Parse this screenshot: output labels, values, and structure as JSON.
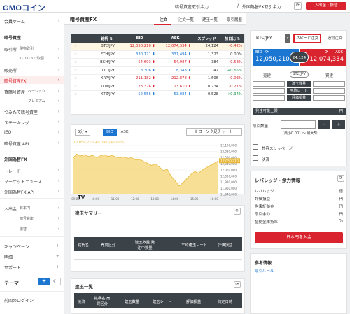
{
  "header": {
    "logo": "GMOコイン",
    "nav": [
      "暗号資産取引余力",
      "/",
      "外国為替FX取引余力"
    ],
    "deposit_button": "入出金・振替"
  },
  "sidebar": {
    "member_home": "会員ホーム",
    "crypto_title": "暗号資産",
    "exchange": "取引所",
    "exchange_sub1": "現物取引",
    "exchange_sub2": "レバレッジ取引",
    "sales": "販売所",
    "crypto_fx": "暗号資産FX",
    "lending": "貸暗号資産",
    "lending_sub1": "ベーシック",
    "lending_sub2": "プレミアム",
    "tsumitate": "つみたて暗号資産",
    "staking": "ステーキング",
    "ieo": "IEO",
    "api": "暗号資産 API",
    "fx_title": "外国為替FX",
    "trade": "トレード",
    "market_news": "マーケットニュース",
    "fx_api": "外国為替FX API",
    "io": "入出金",
    "io_sub1": "日本円",
    "io_sub2": "暗号資産",
    "io_sub3": "振替",
    "campaign": "キャンペーン",
    "statement": "明細",
    "support": "サポート",
    "theme": "テーマ",
    "last_login": "前回のログイン"
  },
  "main": {
    "title": "暗号資産FX",
    "tabs": [
      "注文",
      "注文一覧",
      "建玉一覧",
      "取引履歴"
    ],
    "rate_table": {
      "headers": [
        "銘柄",
        "BID",
        "ASK",
        "スプレッド",
        "前日比"
      ],
      "rows": [
        {
          "symbol": "BTC/JPY",
          "bid": "12,050,210",
          "bid_dir": "up",
          "ask": "12,074,334",
          "ask_dir": "up",
          "spread": "24,124",
          "change": "-0.42%"
        },
        {
          "symbol": "ETH/JPY",
          "bid": "330,171",
          "bid_dir": "down",
          "ask": "331,494",
          "ask_dir": "down",
          "spread": "1,323",
          "change": "0.00%"
        },
        {
          "symbol": "BCH/JPY",
          "bid": "54,603",
          "bid_dir": "up",
          "ask": "54,987",
          "ask_dir": "up",
          "spread": "384",
          "change": "-0.53%"
        },
        {
          "symbol": "LTC/JPY",
          "bid": "8,306",
          "bid_dir": "down",
          "ask": "8,348",
          "ask_dir": "down",
          "spread": "42",
          "change": "+0.65%"
        },
        {
          "symbol": "XRP/JPY",
          "bid": "211.182",
          "bid_dir": "up",
          "ask": "212.878",
          "ask_dir": "up",
          "spread": "1.696",
          "change": "-0.03%"
        },
        {
          "symbol": "XLM/JPY",
          "bid": "23.376",
          "bid_dir": "up",
          "ask": "23.610",
          "ask_dir": "up",
          "spread": "0.234",
          "change": "-0.21%"
        },
        {
          "symbol": "XTZ/JPY",
          "bid": "52.556",
          "bid_dir": "down",
          "ask": "53.084",
          "ask_dir": "down",
          "spread": "0.528",
          "change": "+0.34%"
        }
      ]
    },
    "chart_toolbar": {
      "interval": "5分",
      "bid": "BID",
      "ask": "ASK",
      "candle_button": "ローソク足チャート"
    },
    "chart_annotation": "12,050,210 +0.091 (+0.00%)",
    "summary": {
      "title": "建玉サマリー",
      "headers": [
        "銘柄名",
        "売買区分",
        "建玉数量 発注中数量",
        "平均建玉レート",
        "評価損益"
      ]
    },
    "positions": {
      "title": "建玉一覧",
      "headers": [
        "決済",
        "銘柄名 売買区分",
        "建玉数量",
        "建玉レート",
        "評価損益",
        "約定日時"
      ]
    }
  },
  "chart_data": {
    "type": "area",
    "x": [
      "09:00",
      "10:00",
      "11:00",
      "12:00",
      "13:00",
      "14:00",
      "15:00",
      "16:00"
    ],
    "y_ticks": [
      "12,100,000",
      "12,080,000",
      "12,060,000",
      "12,040,000",
      "12,020,000",
      "12,000,000",
      "11,980,000",
      "11,960,000",
      "11,940,000"
    ],
    "ylim": [
      11940000,
      12100000
    ],
    "current_label": "12,050,210",
    "series": [
      {
        "values": [
          12058000,
          12072000,
          12066000,
          12070000,
          12064000,
          12068000,
          12061000,
          12066000,
          12070000,
          12064000,
          12068000,
          12062000,
          12060000,
          12063000,
          12058000,
          12060000,
          12052000,
          12055000,
          12048000,
          12042000,
          12035000,
          12040000,
          12030000,
          12018000,
          12022000,
          12000000,
          11985000,
          11968000,
          11978000,
          11992000,
          12005000,
          12015000,
          12010000,
          12020000,
          12028000,
          12035000,
          12042000,
          12050210
        ]
      }
    ]
  },
  "order_panel": {
    "symbol": "BTC/JPY",
    "speed_button": "スピード注文",
    "normal_button": "通常注文",
    "bid_label": "BID",
    "bid_value": "12,050,210",
    "ask_label": "ASK",
    "ask_value": "12,074,334",
    "spread": "24,124",
    "sell": "売建",
    "buy": "買建",
    "pair_label": "BTC/JPY",
    "pos_qty": "建玉数量",
    "avg_rate": "平均レート",
    "pnl": "評価損益",
    "orderable": "発注可能上限",
    "orderable_unit": "円",
    "qty_label": "取引数量",
    "qty_hint": "（最小0.001 〜 最大5）",
    "minus": "−",
    "plus": "+",
    "slippage": "許容スリッページ",
    "settle": "決済"
  },
  "leverage_panel": {
    "title": "レバレッジ・余力情報",
    "rows": [
      {
        "label": "レバレッジ",
        "value": "倍"
      },
      {
        "label": "評価損益",
        "value": "円"
      },
      {
        "label": "拘束証拠金",
        "value": "円"
      },
      {
        "label": "取引余力",
        "value": "円"
      },
      {
        "label": "証拠金維持率",
        "value": "%"
      }
    ],
    "deposit_button": "日本円を入金"
  },
  "reference": {
    "title": "参考情報",
    "link": "取引ルール"
  },
  "colors": {
    "red": "#d9232e",
    "blue": "#1b76d2",
    "dark": "#3b4248",
    "chart_fill": "#f5d77a",
    "chart_line": "#e8b83a"
  }
}
